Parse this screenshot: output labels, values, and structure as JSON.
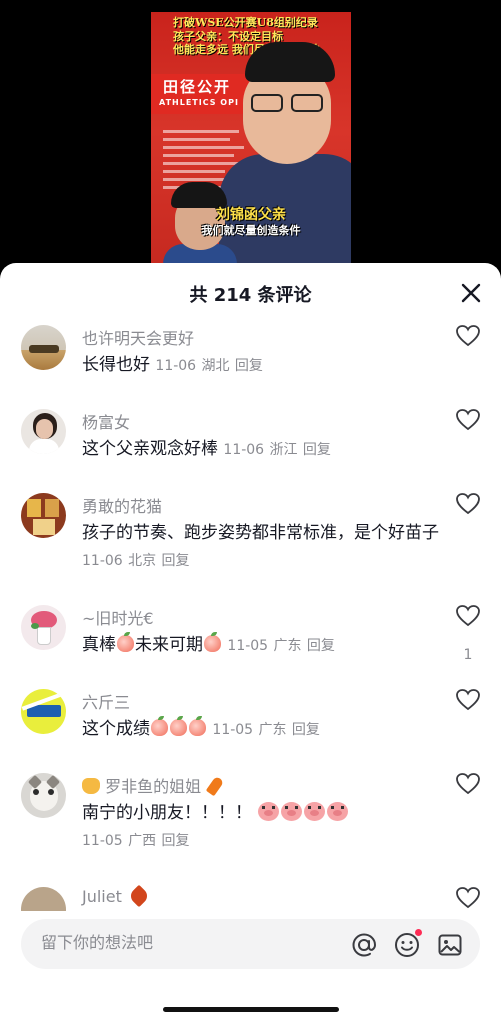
{
  "video": {
    "headline_1": "打破WSE公开赛U8组别纪录",
    "headline_2": "孩子父亲：不设定目标",
    "headline_3": "他能走多远 我们尽量创造条件",
    "board_cn": "田径公开",
    "board_en": "ATHLETICS OPI",
    "speaker_name": "刘锦函父亲",
    "subtitle": "我们就尽量创造条件"
  },
  "sheet": {
    "count_label": "共 214 条评论",
    "close_icon": "close-icon"
  },
  "comments": [
    {
      "username": "也许明天会更好",
      "text": "长得也好",
      "date": "11-06",
      "location": "湖北",
      "reply": "回复",
      "likes": ""
    },
    {
      "username": "杨富女",
      "text": "这个父亲观念好棒",
      "date": "11-06",
      "location": "浙江",
      "reply": "回复",
      "likes": ""
    },
    {
      "username": "勇敢的花猫",
      "text": "孩子的节奏、跑步姿势都非常标准，是个好苗子",
      "date": "11-06",
      "location": "北京",
      "reply": "回复",
      "likes": ""
    },
    {
      "username": "~旧时光€",
      "text_a": "真棒",
      "text_b": "未来可期",
      "date": "11-05",
      "location": "广东",
      "reply": "回复",
      "likes": "1"
    },
    {
      "username": "六斤三",
      "text": "这个成绩",
      "date": "11-05",
      "location": "广东",
      "reply": "回复",
      "likes": ""
    },
    {
      "username": "罗非鱼的姐姐",
      "text": "南宁的小朋友！！！！",
      "date": "11-05",
      "location": "广西",
      "reply": "回复",
      "likes": ""
    },
    {
      "username": "Juliet",
      "text": "",
      "date": "",
      "location": "",
      "reply": "",
      "likes": ""
    }
  ],
  "input": {
    "placeholder": "留下你的想法吧"
  },
  "icons": {
    "mention": "at-icon",
    "emoji": "emoji-icon",
    "image": "image-icon",
    "like": "heart-icon"
  },
  "colors": {
    "accent": "#fe2c55",
    "text_primary": "#161823",
    "text_secondary": "#8a8b91",
    "input_bg": "#f3f3f4"
  }
}
